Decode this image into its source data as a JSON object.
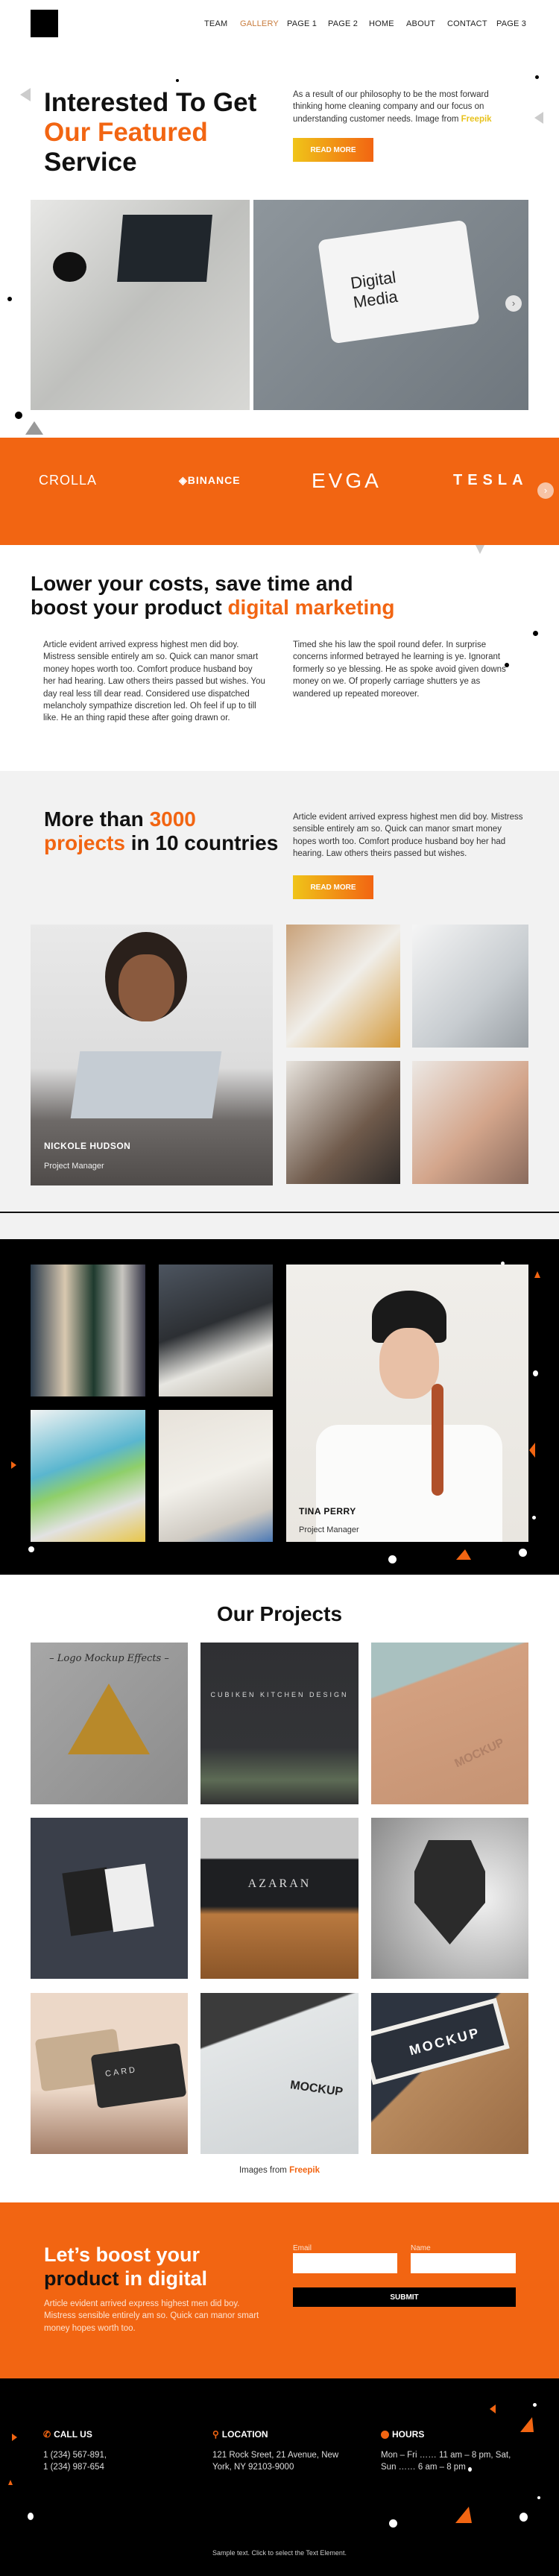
{
  "nav": {
    "items": [
      "TEAM",
      "GALLERY",
      "PAGE 1",
      "PAGE 2",
      "HOME",
      "ABOUT",
      "CONTACT",
      "PAGE 3"
    ],
    "active": "GALLERY",
    "active_color": "#c87b3c"
  },
  "hero": {
    "title_line1": "Interested To Get",
    "title_line2": "Our Featured",
    "title_line3": "Service",
    "text": "As a result of our philosophy to be the most forward thinking home cleaning company and our focus on understanding customer needs. Image from ",
    "link": "Freepik",
    "button": "READ MORE"
  },
  "brands": {
    "items": [
      "CROLLA",
      "BINANCE",
      "EVGA",
      "TESLA"
    ],
    "next_icon": "chevron-right-icon",
    "bg": "#f26512"
  },
  "costs": {
    "title_part1": "Lower your costs, save time and",
    "title_part2": "boost your product ",
    "title_highlight": "digital marketing",
    "col1": "Article evident arrived express highest men did boy. Mistress sensible entirely am so. Quick can manor smart money hopes worth too. Comfort produce husband boy her had hearing. Law others theirs passed but wishes. You day real less till dear read. Considered use dispatched melancholy sympathize discretion led. Oh feel if up to till like. He an thing rapid these after going drawn or.",
    "col2": "Timed she his law the spoil round defer. In surprise concerns informed betrayed he learning is ye. Ignorant formerly so ye blessing. He as spoke avoid given downs money on we. Of properly carriage shutters ye as wandered up repeated moreover."
  },
  "stats": {
    "title_a": "More than ",
    "title_num": "3000",
    "title_b": "projects",
    "title_c": " in 10 countries",
    "text": "Article evident arrived express highest men did boy. Mistress sensible entirely am so. Quick can manor smart money hopes worth too. Comfort produce husband boy her had hearing. Law others theirs passed but wishes.",
    "button": "READ MORE",
    "person": {
      "name": "NICKOLE HUDSON",
      "role": "Project Manager"
    }
  },
  "team": {
    "person": {
      "name": "TINA PERRY",
      "role": "Project Manager"
    }
  },
  "projects": {
    "title": "Our Projects",
    "credit_prefix": "Images from ",
    "credit_link": "Freepik",
    "items": [
      "Logo Mockup Effects",
      "CUBIKEN KITCHEN DESIGN",
      "MOCKUP",
      "Business cards",
      "AZARAN",
      "Lion logo",
      "CARD",
      "MOCKUP",
      "MOCKUP"
    ]
  },
  "cta": {
    "title_line1": "Let’s boost your",
    "title_dark": "product",
    "title_rest": " in digital",
    "text": "Article evident arrived express highest men did boy. Mistress sensible entirely am so. Quick can manor smart money hopes worth too.",
    "email_label": "Email",
    "name_label": "Name",
    "email_value": "",
    "name_value": "",
    "submit": "SUBMIT"
  },
  "footer": {
    "call": {
      "title": "CALL US",
      "icon": "phone-icon",
      "text": "1 (234) 567-891,\n1 (234) 987-654"
    },
    "location": {
      "title": "LOCATION",
      "icon": "map-pin-icon",
      "text": "121 Rock Sreet, 21 Avenue, New York, NY 92103-9000"
    },
    "hours": {
      "title": "HOURS",
      "icon": "clock-icon",
      "text": "Mon – Fri …… 11 am – 8 pm, Sat, Sun  …… 6 am – 8 pm"
    },
    "bottom": "Sample text. Click to select the Text Element."
  }
}
